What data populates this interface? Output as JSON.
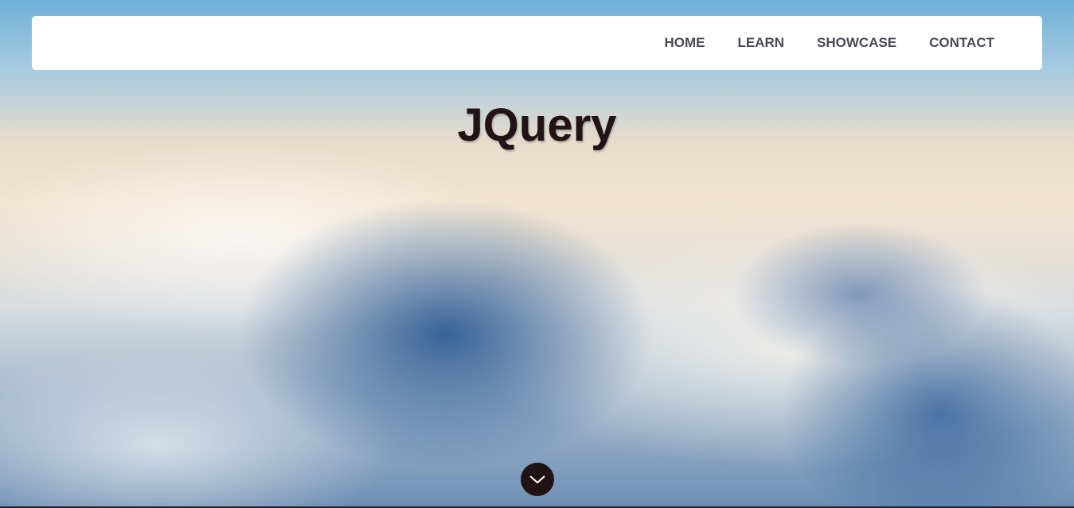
{
  "nav": {
    "items": [
      {
        "label": "HOME"
      },
      {
        "label": "LEARN"
      },
      {
        "label": "SHOWCASE"
      },
      {
        "label": "CONTACT"
      }
    ]
  },
  "hero": {
    "title": "JQuery",
    "scroll_icon": "chevron-down-icon"
  },
  "colors": {
    "title": "#221416",
    "nav_text": "#4a4a55",
    "button_bg": "#211314"
  }
}
